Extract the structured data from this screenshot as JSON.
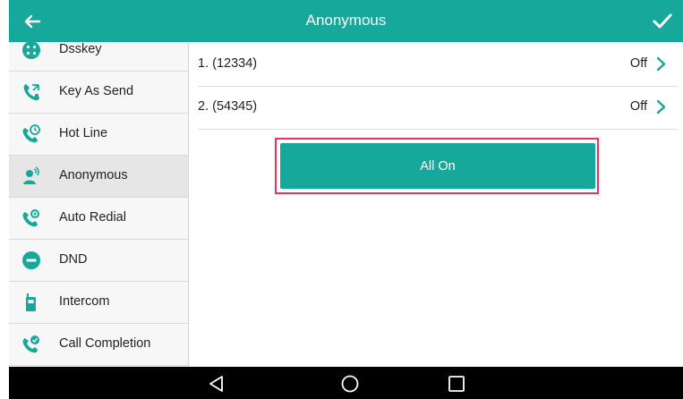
{
  "header": {
    "title": "Anonymous"
  },
  "sidebar": {
    "items": [
      {
        "label": "Dsskey"
      },
      {
        "label": "Key As Send"
      },
      {
        "label": "Hot Line"
      },
      {
        "label": "Anonymous"
      },
      {
        "label": "Auto Redial"
      },
      {
        "label": "DND"
      },
      {
        "label": "Intercom"
      },
      {
        "label": "Call Completion"
      }
    ],
    "active_index": 3
  },
  "list": {
    "rows": [
      {
        "name": "1. (12334)",
        "value": "Off"
      },
      {
        "name": "2. (54345)",
        "value": "Off"
      }
    ]
  },
  "actions": {
    "all_on_label": "All On"
  },
  "colors": {
    "accent": "#16a89b",
    "highlight": "#e0365f",
    "navbar": "#000000"
  },
  "icons": [
    "back-arrow-icon",
    "checkmark-icon",
    "chevron-right-icon",
    "back-triangle-icon",
    "home-circle-icon",
    "recent-square-icon"
  ]
}
